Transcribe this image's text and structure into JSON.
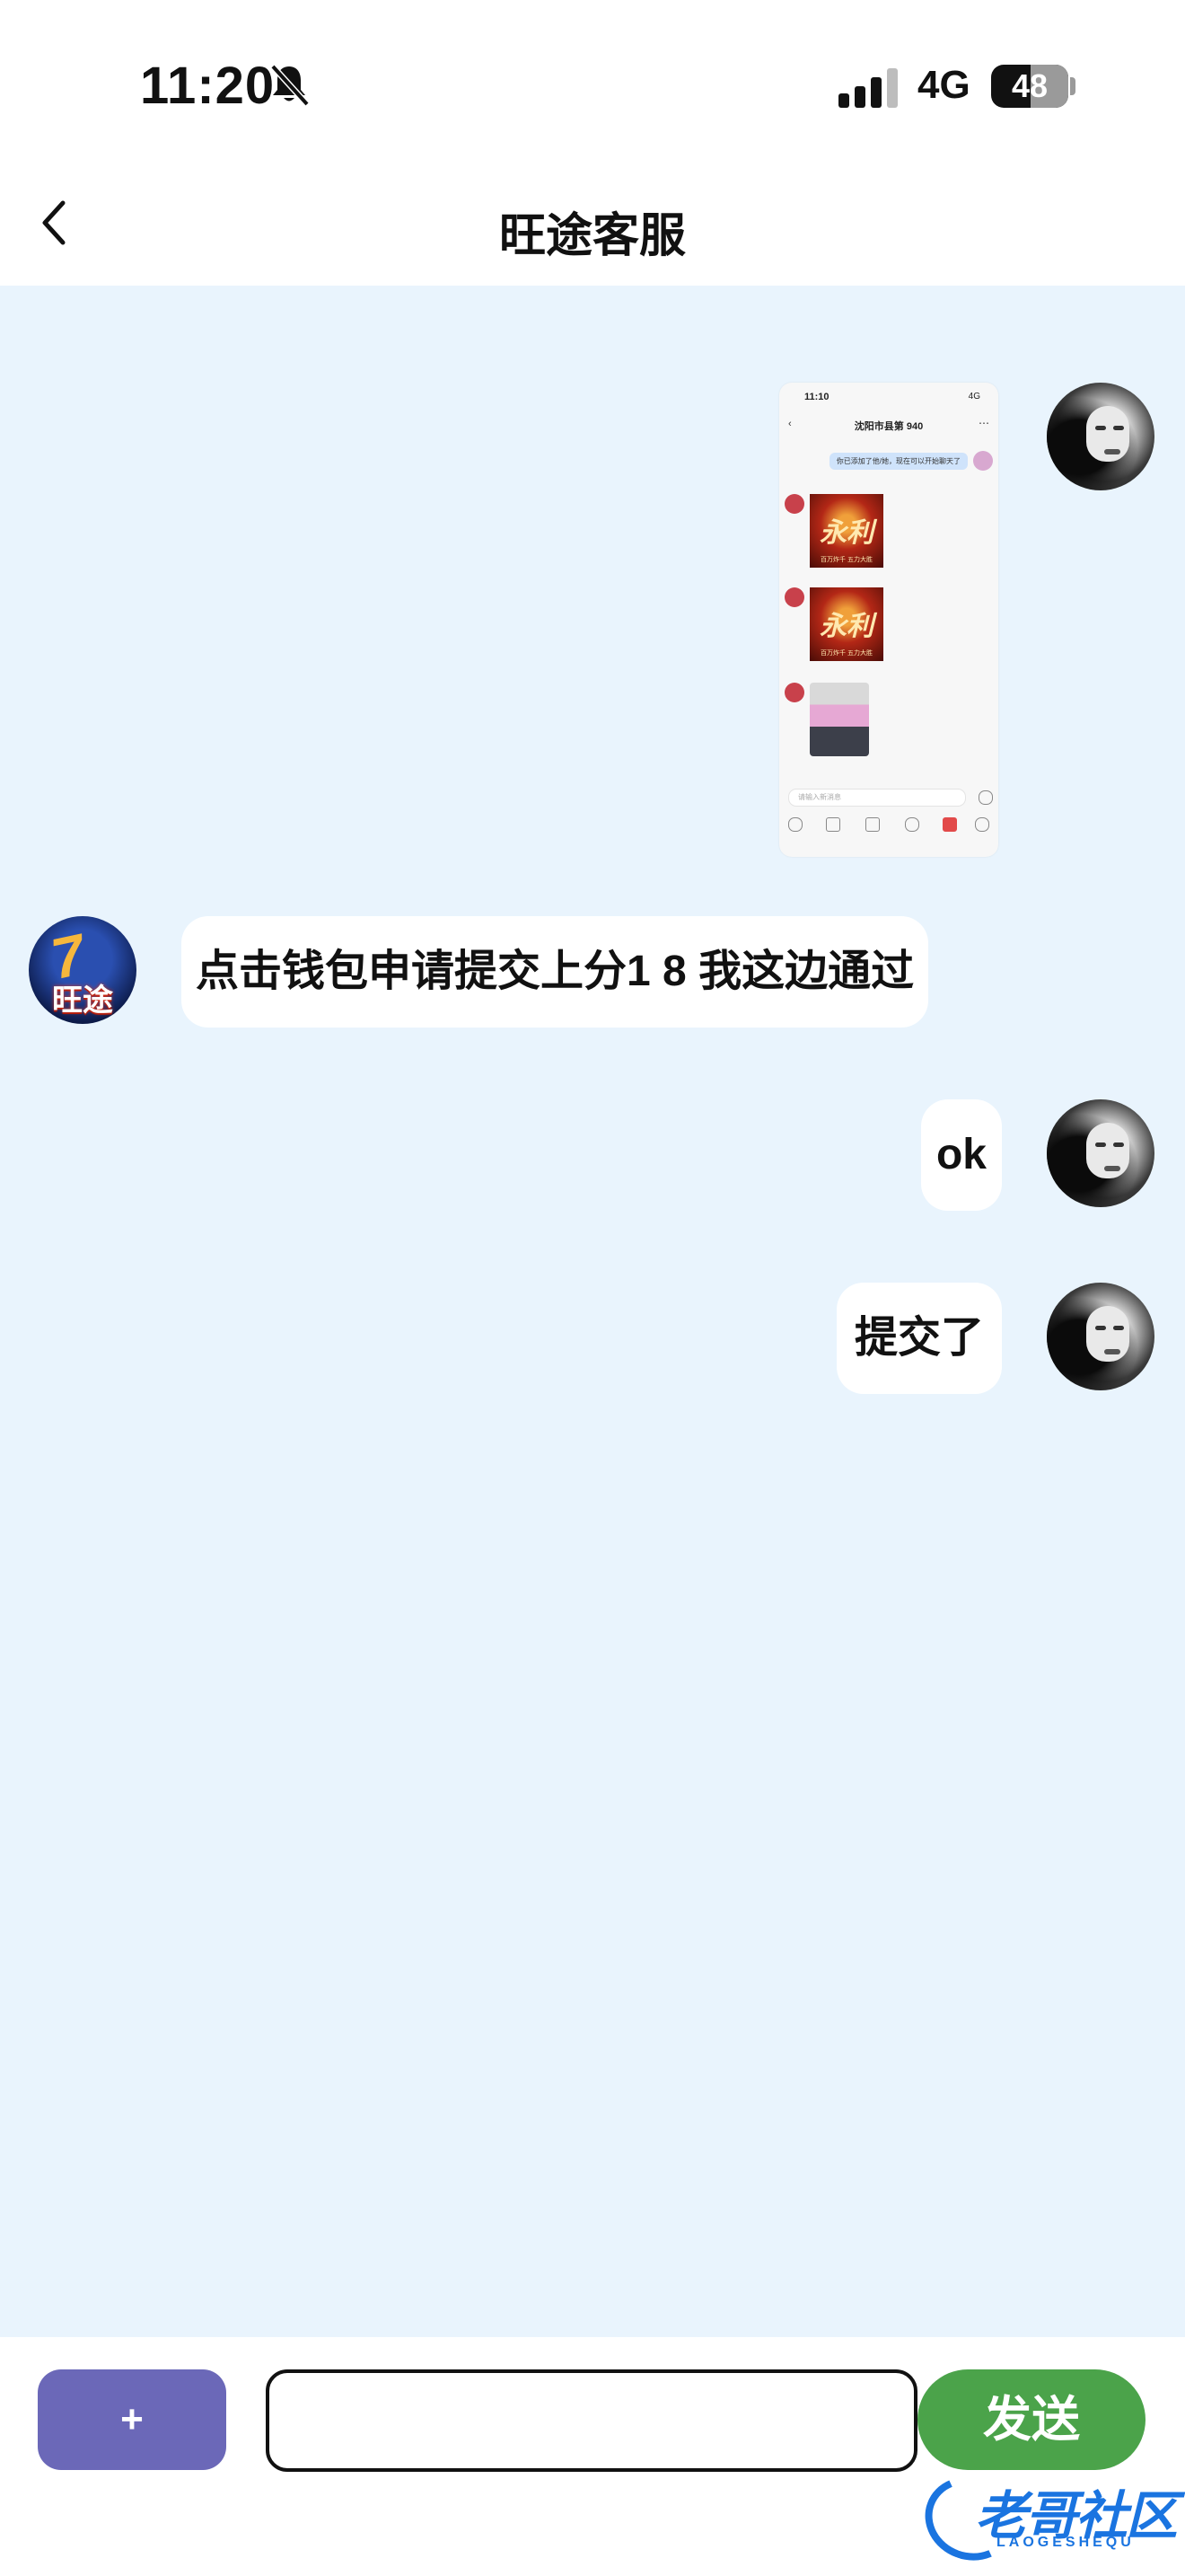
{
  "status_bar": {
    "time": "11:20",
    "network": "4G",
    "battery": "48"
  },
  "header": {
    "title": "旺途客服"
  },
  "messages": [
    {
      "id": "m1",
      "sender": "user",
      "type": "image"
    },
    {
      "id": "m2",
      "sender": "service",
      "type": "text",
      "text": "点击钱包申请提交上分1 8 我这边通过"
    },
    {
      "id": "m3",
      "sender": "user",
      "type": "text",
      "text": "ok"
    },
    {
      "id": "m4",
      "sender": "user",
      "type": "text",
      "text": "提交了"
    }
  ],
  "service_avatar": {
    "brand": "旺途",
    "numeral": "7"
  },
  "composer": {
    "plus_label": "+",
    "input_value": "",
    "send_label": "发送"
  },
  "watermark": {
    "text": "老哥社区",
    "subtext": "LAOGESHEQU"
  },
  "screenshot_thumb": {
    "status_time": "11:10",
    "status_right": "4G",
    "title": "沈阳市县第 940",
    "system_msg": "你已添加了他/她，现在可以开始聊天了",
    "poster_char": "永利",
    "poster_caption": "百万炸千 五力大胜",
    "input_placeholder": "请输入新消息"
  },
  "colors": {
    "chat_bg": "#e9f4fd",
    "plus_button": "#6b68b8",
    "send_button": "#4ba34a",
    "watermark": "#1a74e0"
  }
}
